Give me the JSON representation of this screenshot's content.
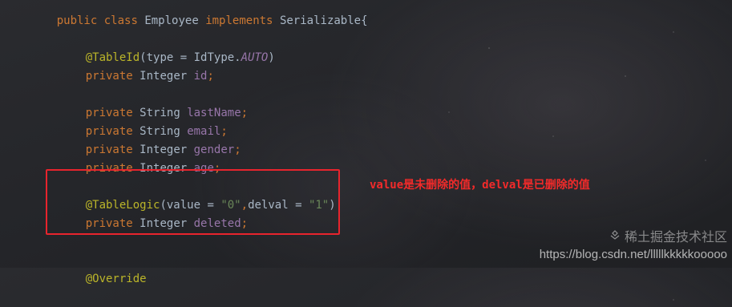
{
  "code": {
    "line_class_decl": {
      "kw_public": "public",
      "kw_class": "class",
      "class_name": "Employee",
      "kw_implements": "implements",
      "iface": "Serializable{"
    },
    "line_tableid": {
      "annotation": "@TableId",
      "open": "(",
      "param": "type",
      "eq": " = ",
      "enum_type": "IdType.",
      "enum_const": "AUTO",
      "close": ")"
    },
    "line_id": {
      "kw_private": "private",
      "type": "Integer",
      "name": "id",
      "semi": ";"
    },
    "line_lastname": {
      "kw_private": "private",
      "type": "String",
      "name": "lastName",
      "semi": ";"
    },
    "line_email": {
      "kw_private": "private",
      "type": "String",
      "name": "email",
      "semi": ";"
    },
    "line_gender": {
      "kw_private": "private",
      "type": "Integer",
      "name": "gender",
      "semi": ";"
    },
    "line_age": {
      "kw_private": "private",
      "type": "Integer",
      "name": "age",
      "semi": ";"
    },
    "line_tablelogic": {
      "annotation": "@TableLogic",
      "open": "(",
      "param1": "value",
      "eq1": " = ",
      "val1": "\"0\"",
      "comma": ",",
      "param2": "delval",
      "eq2": " = ",
      "val2": "\"1\"",
      "close": ")"
    },
    "line_deleted": {
      "kw_private": "private",
      "type": "Integer",
      "name": "deleted",
      "semi": ";"
    },
    "line_override": {
      "annotation": "@Override"
    }
  },
  "annotation_note": "value是未删除的值，delval是已删除的值",
  "watermark": {
    "url": "https://blog.csdn.net/lllllkkkkkooooo",
    "brand": "稀土掘金技术社区"
  },
  "colors": {
    "keyword": "#cc7832",
    "annotation": "#bbb529",
    "field": "#9876aa",
    "string": "#6a8759",
    "text": "#a9b7c6",
    "highlight_border": "#e8242d",
    "note_text": "#f22a2a"
  }
}
